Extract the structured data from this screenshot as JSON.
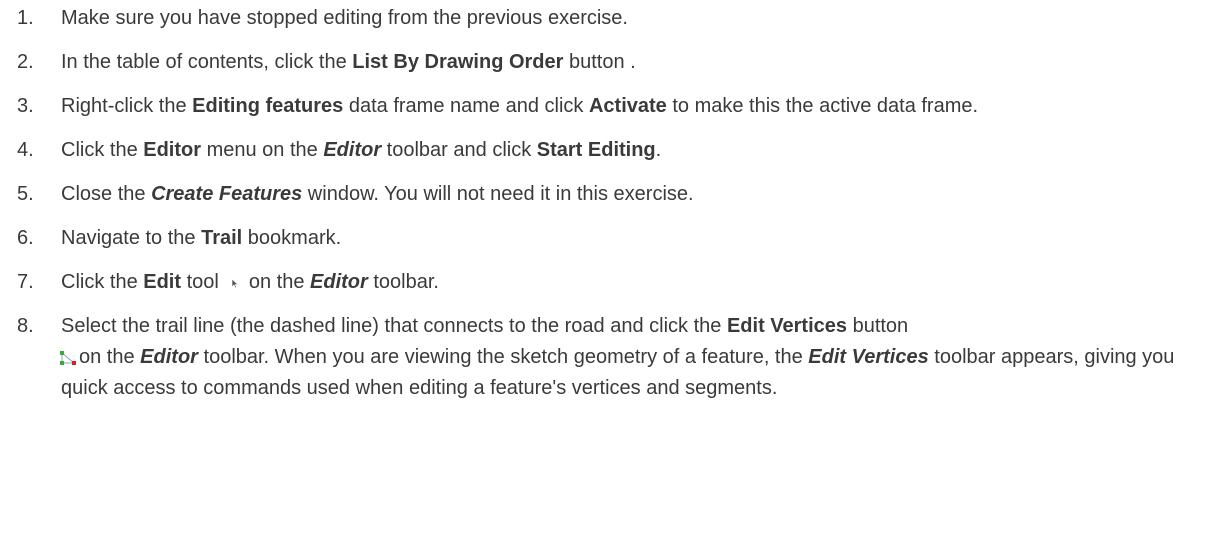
{
  "steps": [
    {
      "num": "1.",
      "text": "Make sure you have stopped editing from the previous exercise."
    },
    {
      "num": "2.",
      "t1": "In the table of contents, click the ",
      "b1": "List By Drawing Order",
      "t2": " button ."
    },
    {
      "num": "3.",
      "t1": "Right-click the ",
      "b1": "Editing features",
      "t2": " data frame name and click ",
      "b2": "Activate",
      "t3": " to make this the active data frame."
    },
    {
      "num": "4.",
      "t1": "Click the ",
      "b1": "Editor",
      "t2": " menu on the ",
      "bi1": "Editor",
      "t3": " toolbar and click ",
      "b2": "Start Editing",
      "t4": "."
    },
    {
      "num": "5.",
      "t1": "Close the ",
      "bi1": "Create Features",
      "t2": " window. You will not need it in this exercise."
    },
    {
      "num": "6.",
      "t1": "Navigate to the ",
      "b1": "Trail",
      "t2": " bookmark."
    },
    {
      "num": "7.",
      "t1": "Click the ",
      "b1": "Edit",
      "t2": " tool",
      "t3": "on the ",
      "bi1": "Editor",
      "t4": " toolbar."
    },
    {
      "num": "8.",
      "t1": "Select the trail line (the dashed line) that connects to the road and click the ",
      "b1": "Edit Vertices",
      "t2": " button ",
      "t3": "on the ",
      "bi1": "Editor",
      "t4": " toolbar. When you are viewing the sketch geometry of a feature, the ",
      "bi2": "Edit Vertices",
      "t5": " toolbar appears, giving you quick access to commands used when editing a feature's vertices and segments."
    }
  ],
  "icons": {
    "edit_tool": "edit-tool-cursor-icon",
    "edit_vertices": "edit-vertices-icon"
  }
}
